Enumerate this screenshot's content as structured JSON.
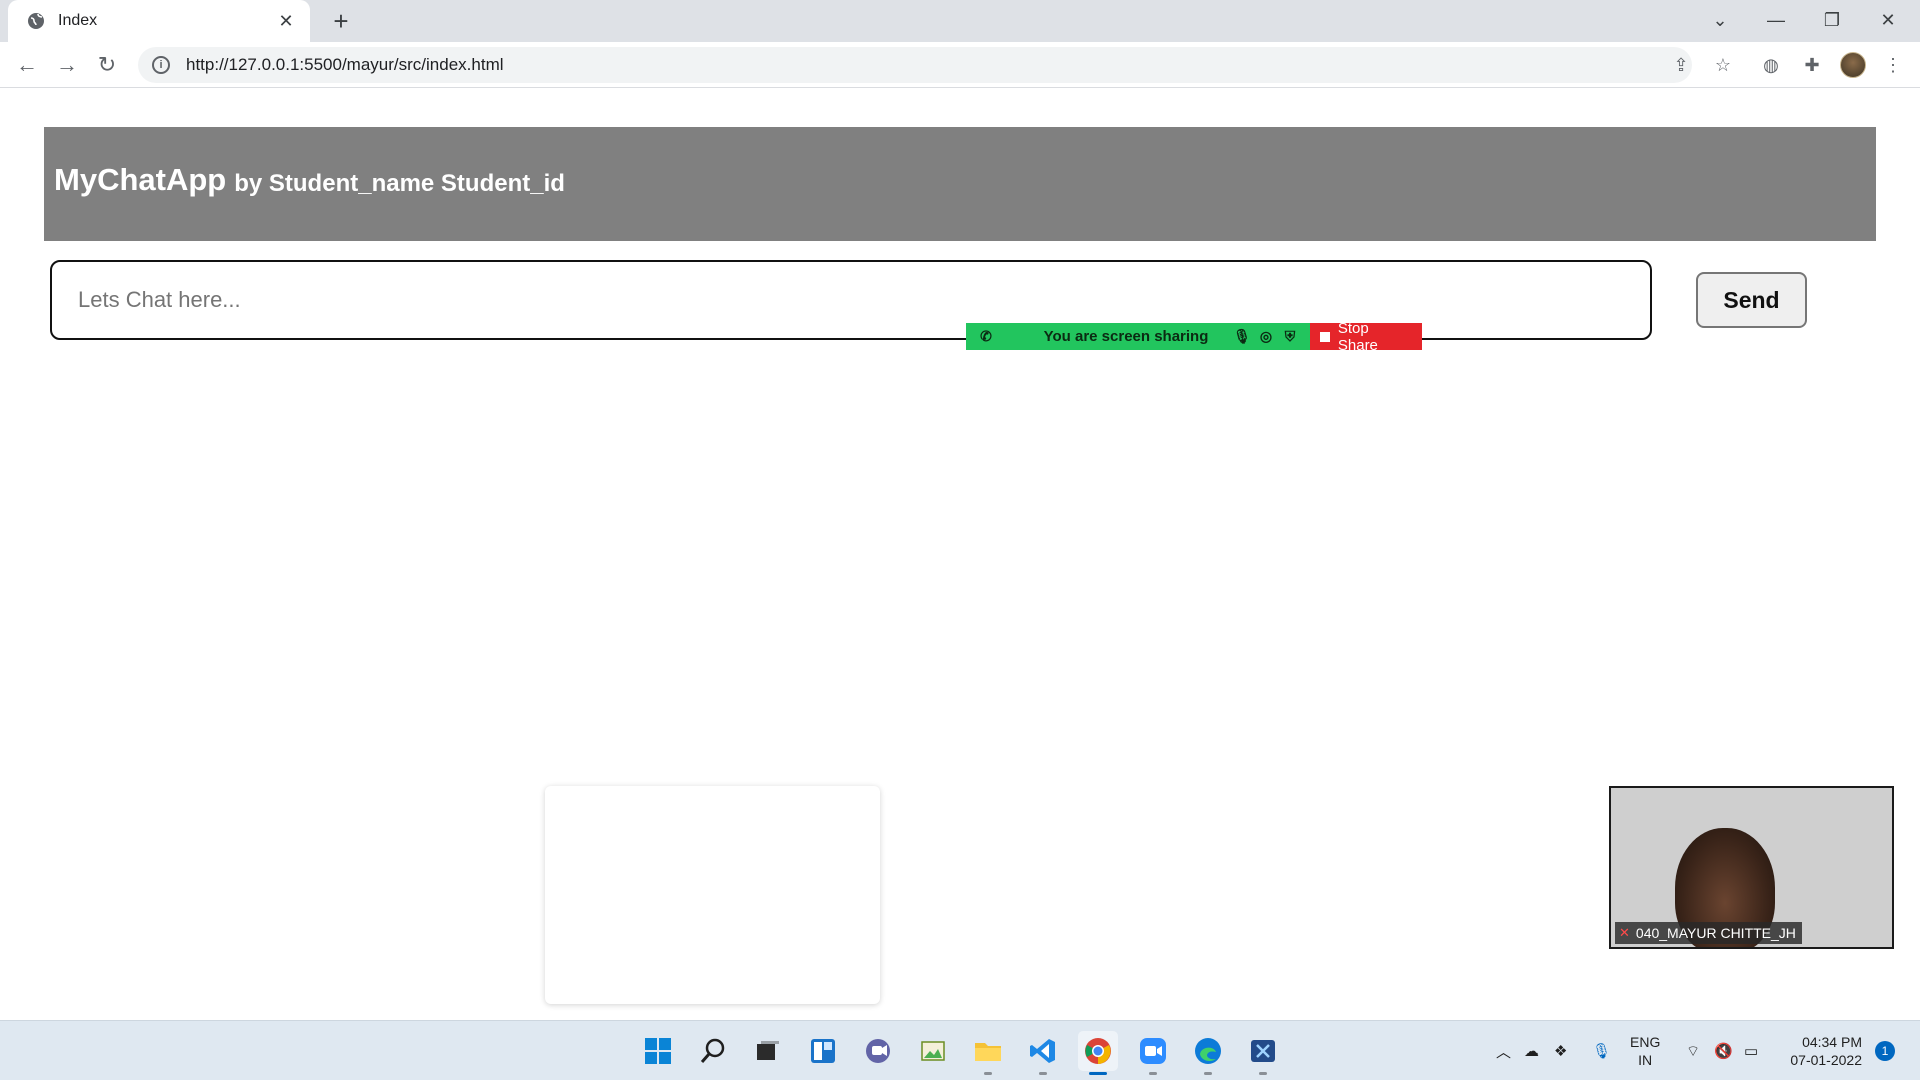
{
  "browser": {
    "tab_title": "Index",
    "url": "http://127.0.0.1:5500/mayur/src/index.html",
    "icons": {
      "back": "arrow-left-icon",
      "forward": "arrow-right-icon",
      "reload": "reload-icon",
      "share": "share-icon",
      "bookmark": "star-icon",
      "extensions": "puzzle-icon"
    }
  },
  "app": {
    "title": "MyChatApp",
    "subtitle": "by Student_name Student_id",
    "header_color": "#808080"
  },
  "chat": {
    "placeholder": "Lets Chat here...",
    "send_label": "Send"
  },
  "zoom": {
    "sharing_text": "You are screen sharing",
    "stop_label": "Stop Share",
    "participant_name": "040_MAYUR CHITTE_JH",
    "bar_color": "#22c55e",
    "stop_color": "#e5252a"
  },
  "taskbar": {
    "lang_line1": "ENG",
    "lang_line2": "IN",
    "time": "04:34 PM",
    "date": "07-01-2022",
    "notifications": "1"
  }
}
